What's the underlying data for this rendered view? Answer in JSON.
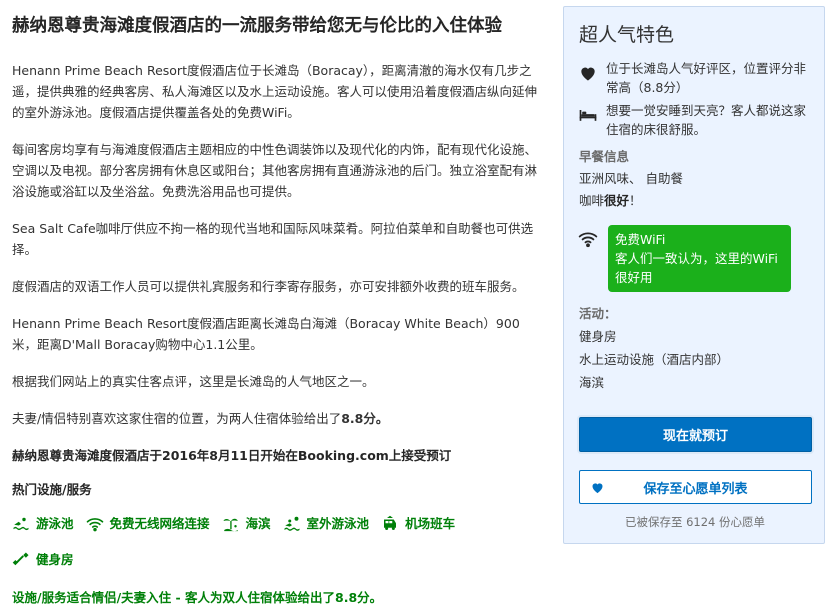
{
  "main": {
    "title": "赫纳恩尊贵海滩度假酒店的一流服务带给您无与伦比的入住体验",
    "paragraphs": [
      "Henann Prime Beach Resort度假酒店位于长滩岛（Boracay），距离清澈的海水仅有几步之遥，提供典雅的经典客房、私人海滩区以及水上运动设施。客人可以使用沿着度假酒店纵向延伸的室外游泳池。度假酒店提供覆盖各处的免费WiFi。",
      "每间客房均享有与海滩度假酒店主题相应的中性色调装饰以及现代化的内饰，配有现代化设施、空调以及电视。部分客房拥有休息区或阳台；其他客房拥有直通游泳池的后门。独立浴室配有淋浴设施或浴缸以及坐浴盆。免费洗浴用品也可提供。",
      "Sea Salt Cafe咖啡厅供应不拘一格的现代当地和国际风味菜肴。阿拉伯菜单和自助餐也可供选择。",
      "度假酒店的双语工作人员可以提供礼宾服务和行李寄存服务，亦可安排额外收费的班车服务。",
      "Henann Prime Beach Resort度假酒店距离长滩岛白海滩（Boracay White Beach）900米，距离D'Mall Boracay购物中心1.1公里。",
      "根据我们网站上的真实住客点评，这里是长滩岛的人气地区之一。"
    ],
    "couples_text": "夫妻/情侣特别喜欢这家住宿的位置，为两人住宿体验给出了",
    "couples_score": "8.8分。",
    "booking_since": "赫纳恩尊贵海滩度假酒店于2016年8月11日开始在Booking.com上接受预订",
    "facilities_heading": "热门设施/服务",
    "facilities": [
      {
        "icon": "swimming-icon",
        "label": "游泳池"
      },
      {
        "icon": "wifi-icon",
        "label": "免费无线网络连接"
      },
      {
        "icon": "beach-icon",
        "label": "海滨"
      },
      {
        "icon": "outdoor-pool-icon",
        "label": "室外游泳池"
      },
      {
        "icon": "shuttle-icon",
        "label": "机场班车"
      },
      {
        "icon": "fitness-icon",
        "label": "健身房"
      }
    ],
    "facilities_note": "设施/服务适合情侣/夫妻入住 - 客人为双人住宿体验给出了8.8分。"
  },
  "sidebar": {
    "title": "超人气特色",
    "highlights": [
      {
        "icon": "heart-icon",
        "text": "位于长滩岛人气好评区，位置评分非常高（8.8分）"
      },
      {
        "icon": "bed-icon",
        "text": "想要一觉安睡到天亮？客人都说这家住宿的床很舒服。"
      }
    ],
    "breakfast_label": "早餐信息",
    "breakfast_types": "亚洲风味、 自助餐",
    "coffee_prefix": "咖啡",
    "coffee_rating": "很好",
    "coffee_suffix": "！",
    "wifi": {
      "title": "免费WiFi",
      "text": "客人们一致认为，这里的WiFi很好用"
    },
    "activities_label": "活动：",
    "activities": [
      "健身房",
      "水上运动设施（酒店内部）",
      "海滨"
    ],
    "book_button": "现在就预订",
    "save_button": "保存至心愿单列表",
    "saved_note": "已被保存至 6124 份心愿单"
  },
  "colors": {
    "accent_blue": "#0071c2",
    "green": "#008009",
    "wifi_green": "#1bb01b",
    "panel_bg": "#ebf3ff"
  }
}
